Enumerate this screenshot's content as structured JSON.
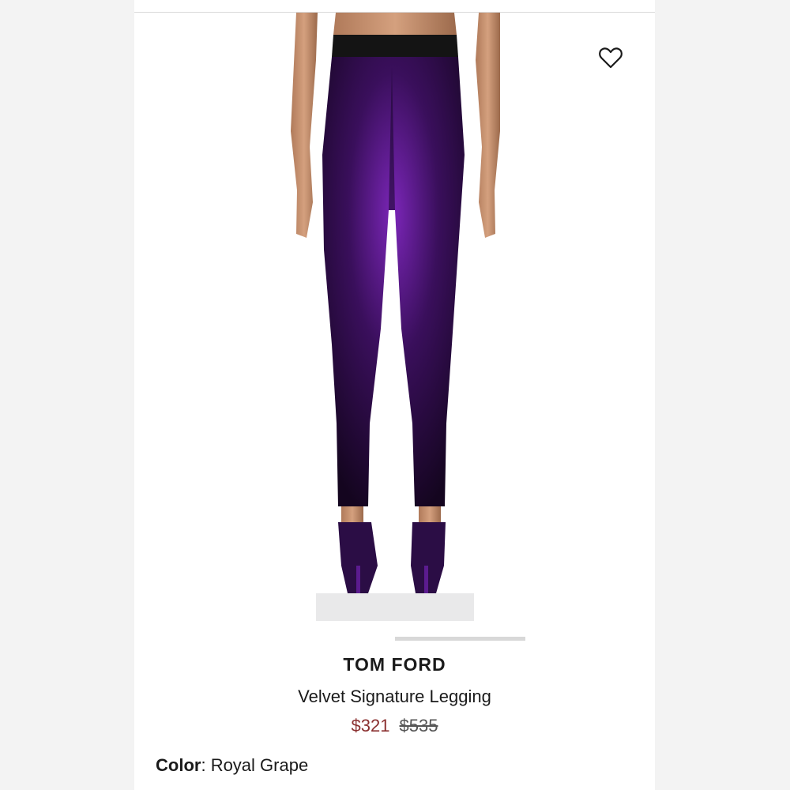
{
  "product": {
    "brand": "TOM FORD",
    "name": "Velvet Signature Legging",
    "sale_price": "$321",
    "original_price": "$535",
    "color_label": "Color",
    "color_separator": ": ",
    "color_value": "Royal Grape"
  },
  "image": {
    "alt": "Model wearing purple velvet leggings, rear view, with purple heels",
    "accent_color": "#5b1b8f"
  },
  "icons": {
    "favorite": "heart-outline-icon"
  },
  "carousel": {
    "progress": 0.5
  }
}
